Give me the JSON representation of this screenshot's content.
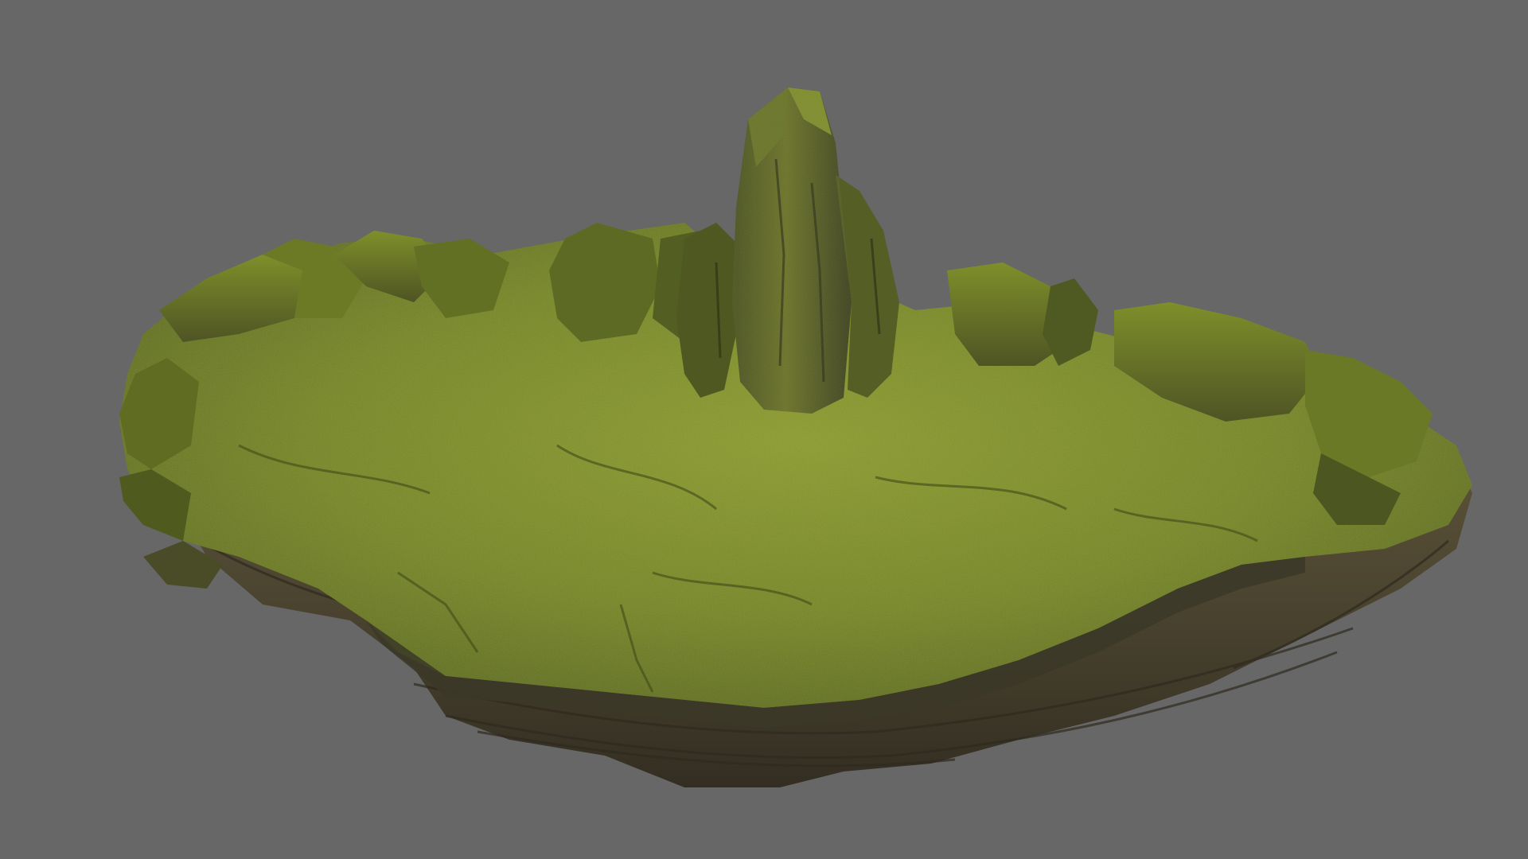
{
  "viewport": {
    "background_color": "#676767",
    "subject": "moss-covered-rock-platform",
    "colors": {
      "moss_light": "#8a9a2a",
      "moss_mid": "#6f8022",
      "moss_dark": "#4d5a1c",
      "rock_light": "#6e6446",
      "rock_mid": "#564d36",
      "rock_dark": "#3a3426",
      "shadow": "#2c281d"
    }
  }
}
